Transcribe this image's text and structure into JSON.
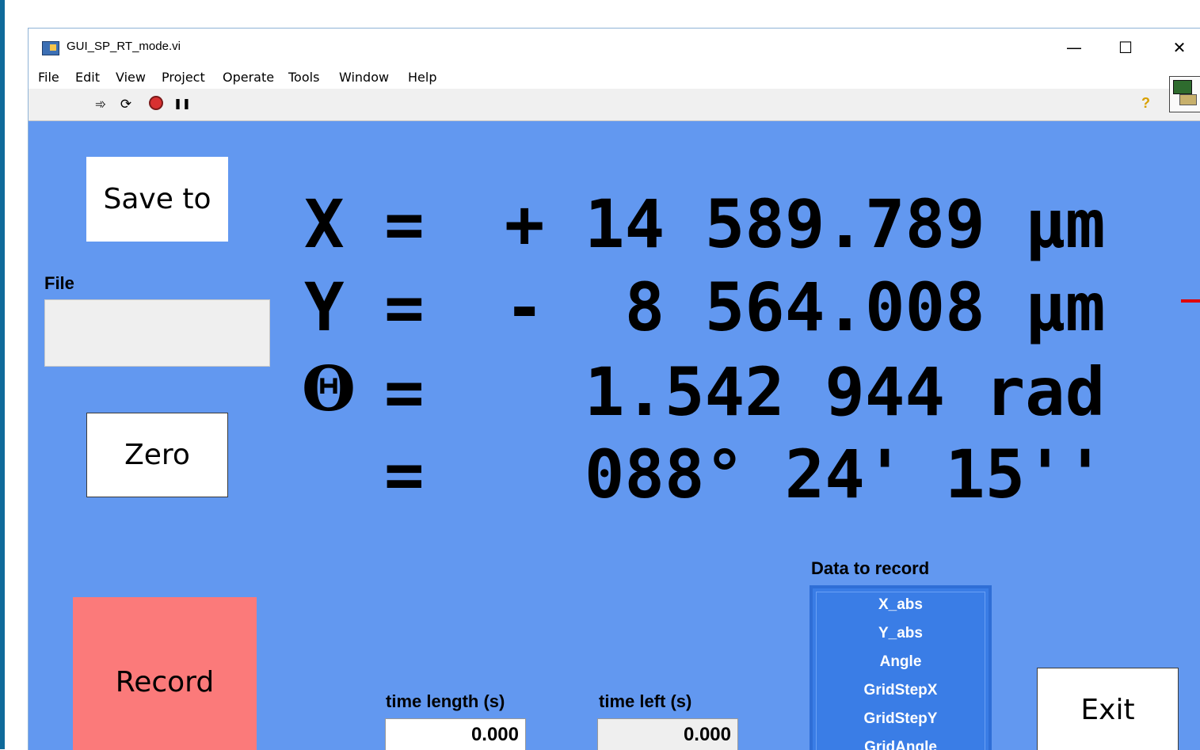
{
  "window": {
    "title": "GUI_SP_RT_mode.vi",
    "minimize_glyph": "—",
    "maximize_glyph": "☐",
    "close_glyph": "✕"
  },
  "menu": {
    "items": [
      "File",
      "Edit",
      "View",
      "Project",
      "Operate",
      "Tools",
      "Window",
      "Help"
    ]
  },
  "toolbar": {
    "run_glyph": "➾",
    "run_continuous_glyph": "⟳",
    "pause_glyph": "❚❚",
    "help_glyph": "?"
  },
  "panel": {
    "save_to_label": "Save to",
    "file_label": "File",
    "file_value": "",
    "zero_label": "Zero",
    "record_label": "Record",
    "exit_label": "Exit",
    "record_color": "#fb7a7a",
    "background_color": "#6298f0"
  },
  "readouts": {
    "x_line": "X =  + 14 589.789 µm",
    "y_line": "Y =  -  8 564.008 µm",
    "theta_symbol": "Θ",
    "theta_line": "=    1.542 944 rad",
    "deg_line": "=    088° 24' 15''"
  },
  "timing": {
    "time_length_label": "time length (s)",
    "time_length_value": "0.000",
    "time_left_label": "time left (s)",
    "time_left_value": "0.000"
  },
  "data_to_record": {
    "label": "Data to record",
    "items": [
      "X_abs",
      "Y_abs",
      "Angle",
      "GridStepX",
      "GridStepY",
      "GridAngle"
    ]
  }
}
